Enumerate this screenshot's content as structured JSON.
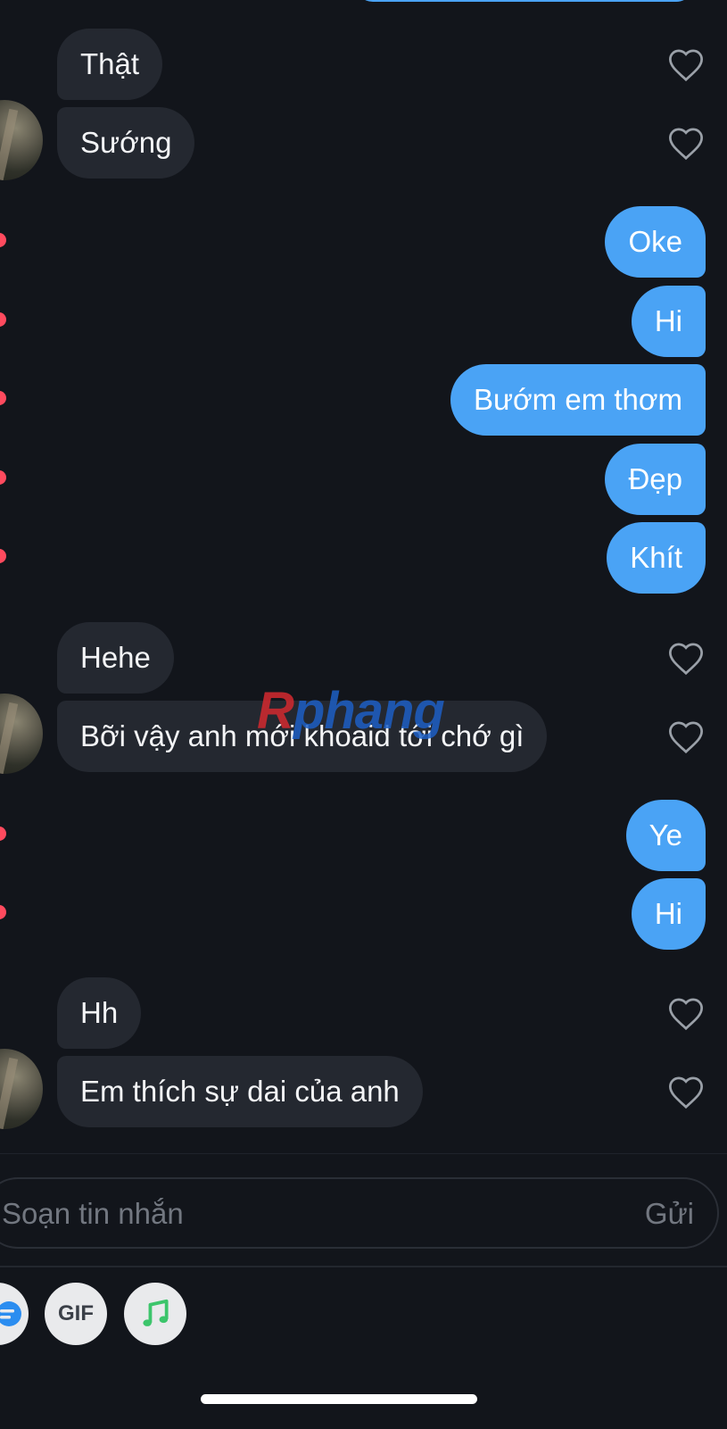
{
  "conversation": {
    "messages": [
      {
        "text": "Thật",
        "from": "them"
      },
      {
        "text": "Sướng",
        "from": "them"
      },
      {
        "text": "Oke",
        "from": "me"
      },
      {
        "text": "Hi",
        "from": "me"
      },
      {
        "text": "Bướm em thơm",
        "from": "me"
      },
      {
        "text": "Đẹp",
        "from": "me"
      },
      {
        "text": "Khít",
        "from": "me"
      },
      {
        "text": "Hehe",
        "from": "them"
      },
      {
        "text": "Bỡi vậy anh mới khoaid tới chớ gì",
        "from": "them"
      },
      {
        "text": "Ye",
        "from": "me"
      },
      {
        "text": "Hi",
        "from": "me"
      },
      {
        "text": "Hh",
        "from": "them"
      },
      {
        "text": "Em thích sự dai của anh",
        "from": "them"
      }
    ]
  },
  "watermark": {
    "part1": "R",
    "part2": "phang"
  },
  "composer": {
    "placeholder": "Soạn tin nhắn",
    "send_label": "Gửi"
  },
  "toolbar": {
    "gif_label": "GIF"
  },
  "colors": {
    "background": "#12151b",
    "incoming_bubble": "#242830",
    "outgoing_bubble": "#4aa3f5",
    "unread_dot": "#ff4a5e",
    "music_icon": "#3cc56b",
    "accent_blue": "#2b8df0"
  },
  "icons": [
    "heart-outline-icon",
    "gif-icon",
    "music-note-icon",
    "sticker-icon"
  ]
}
